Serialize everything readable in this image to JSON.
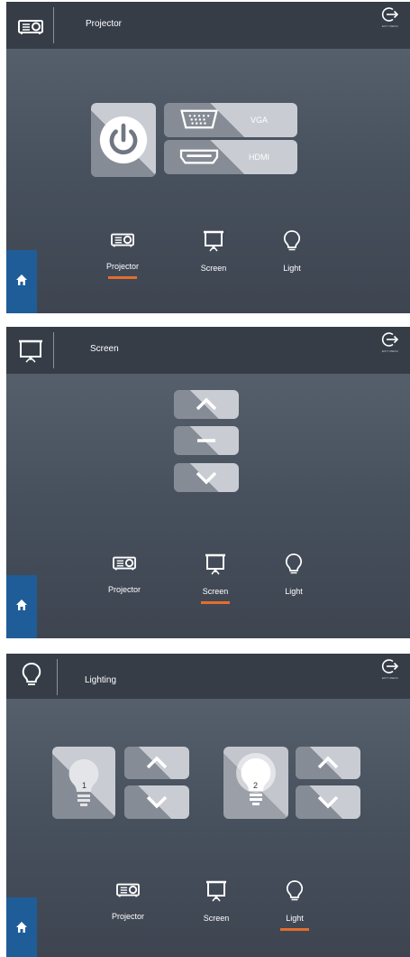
{
  "panels": {
    "projector": {
      "title": "Projector",
      "exit_label": "EXIT MENU",
      "inputs": [
        {
          "label": "VGA",
          "icon": "vga-port-icon"
        },
        {
          "label": "HDMI",
          "icon": "hdmi-port-icon"
        }
      ],
      "power_icon": "power-icon"
    },
    "screen": {
      "title": "Screen",
      "exit_label": "EXIT MENU",
      "controls": [
        "up",
        "stop",
        "down"
      ]
    },
    "lighting": {
      "title": "Lighting",
      "exit_label": "EXIT MENU",
      "lights": [
        {
          "number": "1",
          "state": "dim"
        },
        {
          "number": "2",
          "state": "on"
        }
      ]
    }
  },
  "nav": {
    "projector": "Projector",
    "screen": "Screen",
    "light": "Light"
  },
  "colors": {
    "header": "#363d47",
    "accent_underline": "#e46d2e",
    "home_button": "#1f5d99",
    "tile": "#c9ccd2"
  }
}
